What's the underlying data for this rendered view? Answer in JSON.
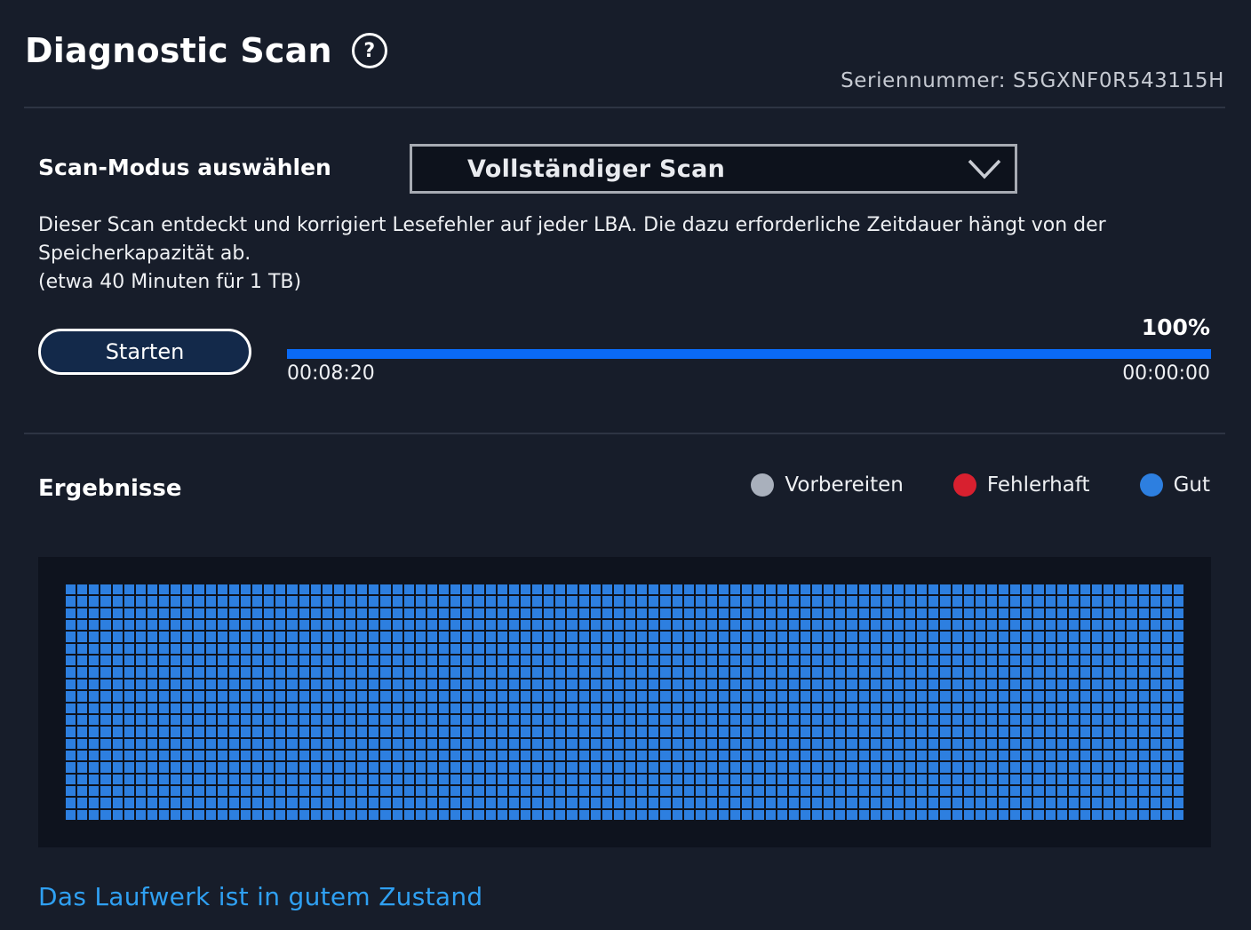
{
  "header": {
    "title": "Diagnostic Scan",
    "help_icon": "help-circle-icon",
    "serial": "Seriennummer: S5GXNF0R543115H"
  },
  "scan_mode": {
    "label": "Scan-Modus auswählen",
    "selected": "Vollständiger Scan",
    "dropdown_icon": "chevron-down-icon"
  },
  "description": {
    "line1": "Dieser Scan entdeckt und korrigiert Lesefehler auf jeder LBA. Die dazu erforderliche Zeitdauer hängt von der Speicherkapazität ab.",
    "line2": "(etwa 40 Minuten für 1 TB)"
  },
  "controls": {
    "start_label": "Starten"
  },
  "progress": {
    "percent_label": "100%",
    "value": 100,
    "elapsed": "00:08:20",
    "remaining": "00:00:00"
  },
  "results": {
    "title": "Ergebnisse",
    "legend": [
      {
        "label": "Vorbereiten",
        "color": "#a9b0bc"
      },
      {
        "label": "Fehlerhaft",
        "color": "#d8202f"
      },
      {
        "label": "Gut",
        "color": "#2d7fe0"
      }
    ],
    "grid": {
      "columns": 96,
      "rows": 20,
      "state": "Gut",
      "cell_color": "#2d7fe0"
    },
    "status": "Das Laufwerk ist in gutem Zustand"
  },
  "colors": {
    "background": "#171d2a",
    "accent": "#0a6af5",
    "status_text": "#2fa0f2"
  }
}
